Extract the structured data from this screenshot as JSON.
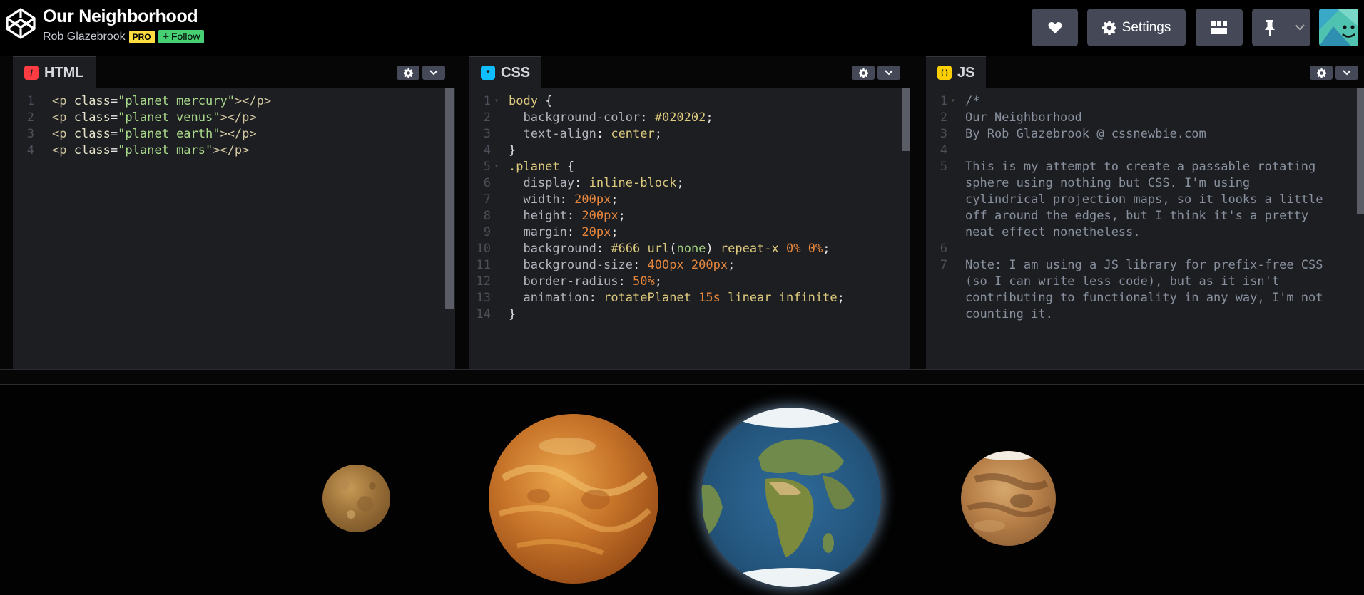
{
  "header": {
    "title": "Our Neighborhood",
    "author": "Rob Glazebrook",
    "pro_badge": "PRO",
    "follow_label": "Follow",
    "settings_label": "Settings"
  },
  "icons": {
    "logo": "codepen-logo-icon",
    "heart": "heart-icon",
    "settings": "gear-icon",
    "layout": "layout-grid-icon",
    "pin": "pin-icon",
    "dropdown": "chevron-down-icon"
  },
  "colors": {
    "pro": "#ffdd40",
    "follow": "#47cf73",
    "html_tab": "#ff3c41",
    "css_tab": "#0ebeff",
    "js_tab": "#fcd000",
    "button_bg": "#444857"
  },
  "editors": {
    "html": {
      "label": "HTML",
      "icon": "/",
      "lines": [
        {
          "n": "1",
          "segs": [
            [
              "t-tag",
              "<p "
            ],
            [
              "t-attr",
              "class"
            ],
            [
              "t-punc",
              "="
            ],
            [
              "t-str",
              "\"planet mercury\""
            ],
            [
              "t-tag",
              "></p>"
            ]
          ]
        },
        {
          "n": "2",
          "segs": [
            [
              "t-tag",
              "<p "
            ],
            [
              "t-attr",
              "class"
            ],
            [
              "t-punc",
              "="
            ],
            [
              "t-str",
              "\"planet venus\""
            ],
            [
              "t-tag",
              "></p>"
            ]
          ]
        },
        {
          "n": "3",
          "segs": [
            [
              "t-tag",
              "<p "
            ],
            [
              "t-attr",
              "class"
            ],
            [
              "t-punc",
              "="
            ],
            [
              "t-str",
              "\"planet earth\""
            ],
            [
              "t-tag",
              "></p>"
            ]
          ]
        },
        {
          "n": "4",
          "segs": [
            [
              "t-tag",
              "<p "
            ],
            [
              "t-attr",
              "class"
            ],
            [
              "t-punc",
              "="
            ],
            [
              "t-str",
              "\"planet mars\""
            ],
            [
              "t-tag",
              "></p>"
            ]
          ]
        }
      ]
    },
    "css": {
      "label": "CSS",
      "icon": "*",
      "lines": [
        {
          "n": "1",
          "fold": true,
          "segs": [
            [
              "t-sel",
              "body "
            ],
            [
              "t-punc",
              "{"
            ]
          ]
        },
        {
          "n": "2",
          "segs": [
            [
              "t-prop",
              "  background-color"
            ],
            [
              "t-punc",
              ": "
            ],
            [
              "t-val",
              "#020202"
            ],
            [
              "t-punc",
              ";"
            ]
          ]
        },
        {
          "n": "3",
          "segs": [
            [
              "t-prop",
              "  text-align"
            ],
            [
              "t-punc",
              ": "
            ],
            [
              "t-val",
              "center"
            ],
            [
              "t-punc",
              ";"
            ]
          ]
        },
        {
          "n": "4",
          "segs": [
            [
              "t-punc",
              "}"
            ]
          ]
        },
        {
          "n": "5",
          "fold": true,
          "segs": [
            [
              "t-sel",
              ".planet "
            ],
            [
              "t-punc",
              "{"
            ]
          ]
        },
        {
          "n": "6",
          "segs": [
            [
              "t-prop",
              "  display"
            ],
            [
              "t-punc",
              ": "
            ],
            [
              "t-val",
              "inline-block"
            ],
            [
              "t-punc",
              ";"
            ]
          ]
        },
        {
          "n": "7",
          "segs": [
            [
              "t-prop",
              "  width"
            ],
            [
              "t-punc",
              ": "
            ],
            [
              "t-num",
              "200px"
            ],
            [
              "t-punc",
              ";"
            ]
          ]
        },
        {
          "n": "8",
          "segs": [
            [
              "t-prop",
              "  height"
            ],
            [
              "t-punc",
              ": "
            ],
            [
              "t-num",
              "200px"
            ],
            [
              "t-punc",
              ";"
            ]
          ]
        },
        {
          "n": "9",
          "segs": [
            [
              "t-prop",
              "  margin"
            ],
            [
              "t-punc",
              ": "
            ],
            [
              "t-num",
              "20px"
            ],
            [
              "t-punc",
              ";"
            ]
          ]
        },
        {
          "n": "10",
          "segs": [
            [
              "t-prop",
              "  background"
            ],
            [
              "t-punc",
              ": "
            ],
            [
              "t-val",
              "#666 "
            ],
            [
              "t-val",
              "url"
            ],
            [
              "t-punc",
              "("
            ],
            [
              "t-fn",
              "none"
            ],
            [
              "t-punc",
              ") "
            ],
            [
              "t-val",
              "repeat-x "
            ],
            [
              "t-num",
              "0% 0%"
            ],
            [
              "t-punc",
              ";"
            ]
          ]
        },
        {
          "n": "11",
          "segs": [
            [
              "t-prop",
              "  background-size"
            ],
            [
              "t-punc",
              ": "
            ],
            [
              "t-num",
              "400px 200px"
            ],
            [
              "t-punc",
              ";"
            ]
          ]
        },
        {
          "n": "12",
          "segs": [
            [
              "t-prop",
              "  border-radius"
            ],
            [
              "t-punc",
              ": "
            ],
            [
              "t-num",
              "50%"
            ],
            [
              "t-punc",
              ";"
            ]
          ]
        },
        {
          "n": "13",
          "segs": [
            [
              "t-prop",
              "  animation"
            ],
            [
              "t-punc",
              ": "
            ],
            [
              "t-val",
              "rotatePlanet "
            ],
            [
              "t-num",
              "15s "
            ],
            [
              "t-val",
              "linear infinite"
            ],
            [
              "t-punc",
              ";"
            ]
          ]
        },
        {
          "n": "14",
          "segs": [
            [
              "t-punc",
              "}"
            ]
          ]
        }
      ]
    },
    "js": {
      "label": "JS",
      "icon": "( )",
      "lines": [
        {
          "n": "1",
          "fold": true,
          "segs": [
            [
              "t-comment",
              "/*"
            ]
          ]
        },
        {
          "n": "2",
          "segs": [
            [
              "t-comment",
              "Our Neighborhood"
            ]
          ]
        },
        {
          "n": "3",
          "segs": [
            [
              "t-comment",
              "By Rob Glazebrook @ cssnewbie.com"
            ]
          ]
        },
        {
          "n": "4",
          "segs": [
            [
              "t-comment",
              ""
            ]
          ]
        },
        {
          "n": "5",
          "segs": [
            [
              "t-comment",
              "This is my attempt to create a passable rotating"
            ]
          ]
        },
        {
          "n": "",
          "segs": [
            [
              "t-comment",
              "sphere using nothing but CSS. I'm using"
            ]
          ]
        },
        {
          "n": "",
          "segs": [
            [
              "t-comment",
              "cylindrical projection maps, so it looks a little"
            ]
          ]
        },
        {
          "n": "",
          "segs": [
            [
              "t-comment",
              "off around the edges, but I think it's a pretty"
            ]
          ]
        },
        {
          "n": "",
          "segs": [
            [
              "t-comment",
              "neat effect nonetheless."
            ]
          ]
        },
        {
          "n": "6",
          "segs": [
            [
              "t-comment",
              ""
            ]
          ]
        },
        {
          "n": "7",
          "segs": [
            [
              "t-comment",
              "Note: I am using a JS library for prefix-free CSS"
            ]
          ]
        },
        {
          "n": "",
          "segs": [
            [
              "t-comment",
              "(so I can write less code), but as it isn't"
            ]
          ]
        },
        {
          "n": "",
          "segs": [
            [
              "t-comment",
              "contributing to functionality in any way, I'm not"
            ]
          ]
        },
        {
          "n": "",
          "segs": [
            [
              "t-comment",
              "counting it."
            ]
          ]
        }
      ]
    }
  }
}
